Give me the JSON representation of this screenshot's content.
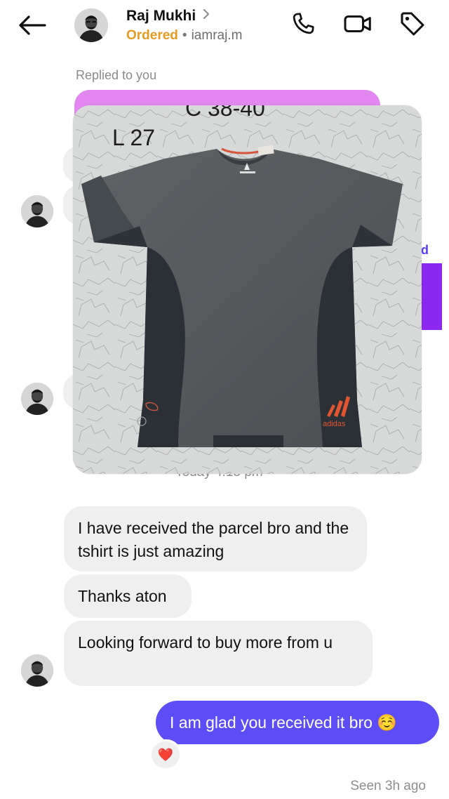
{
  "header": {
    "name": "Raj Mukhi",
    "status": "Ordered",
    "separator": "•",
    "username": "iamraj.m",
    "icons": [
      "back-arrow-icon",
      "phone-icon",
      "video-icon",
      "tag-icon"
    ]
  },
  "chat": {
    "replied_label": "Replied to you",
    "photo": {
      "size_line_1": "C 38-40",
      "size_line_2": "L 27",
      "brand": "adidas"
    },
    "timestamp": "Today 4:13 pm",
    "messages_in": [
      "I have received the parcel bro and the tshirt is just amazing",
      "Thanks aton",
      "Looking forward to buy more from u"
    ],
    "message_out": "I am glad you received it bro ☺️",
    "reaction": "❤️",
    "seen": "Seen 3h ago"
  },
  "colors": {
    "accent": "#5d4df7",
    "ordered": "#e69a1e",
    "incoming_bubble": "#efefef",
    "reply_bubble": "#e287ef"
  }
}
